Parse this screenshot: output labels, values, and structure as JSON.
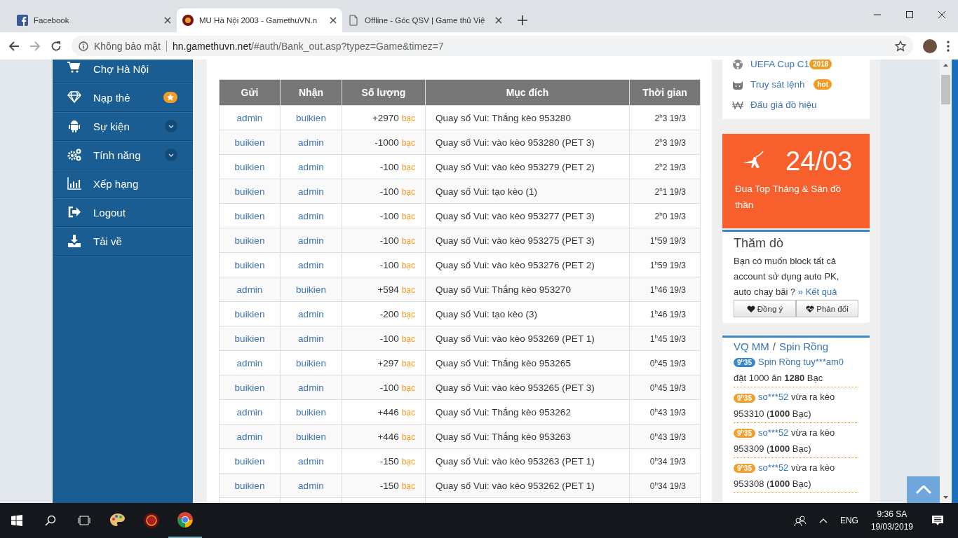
{
  "browser": {
    "tabs": [
      {
        "kind": "facebook",
        "title": "Facebook",
        "selected": false
      },
      {
        "kind": "game",
        "title": "MU Hà Nội 2003 - GamethuVN.n",
        "selected": true
      },
      {
        "kind": "page",
        "title": "Offline - Góc QSV | Game thủ Việ",
        "selected": false
      }
    ],
    "address": {
      "security": "Không bảo mật",
      "host": "hn.gamethuvn.net",
      "path": "/#auth/Bank_out.asp?typez=Game&timez=7"
    }
  },
  "sidebar": {
    "items": [
      {
        "label": "Chợ Hà Nội",
        "kind": "plain"
      },
      {
        "label": "Nạp thẻ",
        "kind": "star"
      },
      {
        "label": "Sự kiện",
        "kind": "chevron"
      },
      {
        "label": "Tính năng",
        "kind": "chevron"
      },
      {
        "label": "Xếp hạng",
        "kind": "plain"
      },
      {
        "label": "Logout",
        "kind": "plain"
      },
      {
        "label": "Tải về",
        "kind": "plain"
      }
    ]
  },
  "table": {
    "columns": [
      "Gửi",
      "Nhận",
      "Số lượng",
      "Mục đích",
      "Thời gian"
    ],
    "rows": [
      {
        "sender": "admin",
        "receiver": "buikien",
        "amount": "+2970",
        "currency": "bạc",
        "purpose": "Quay số Vui: Thắng kèo 953280",
        "time": "2$^{h}$3 19/3"
      },
      {
        "sender": "buikien",
        "receiver": "admin",
        "amount": "-1000",
        "currency": "bạc",
        "purpose": "Quay số Vui: vào kèo 953280 (PET 3)",
        "time": "2$^{h}$3 19/3"
      },
      {
        "sender": "buikien",
        "receiver": "admin",
        "amount": "-100",
        "currency": "bạc",
        "purpose": "Quay số Vui: vào kèo 953279 (PET 2)",
        "time": "2$^{h}$2 19/3"
      },
      {
        "sender": "buikien",
        "receiver": "admin",
        "amount": "-100",
        "currency": "bạc",
        "purpose": "Quay số Vui: tạo kèo (1)",
        "time": "2$^{h}$1 19/3"
      },
      {
        "sender": "buikien",
        "receiver": "admin",
        "amount": "-100",
        "currency": "bạc",
        "purpose": "Quay số Vui: vào kèo 953277 (PET 3)",
        "time": "2$^{h}$0 19/3"
      },
      {
        "sender": "buikien",
        "receiver": "admin",
        "amount": "-100",
        "currency": "bạc",
        "purpose": "Quay số Vui: vào kèo 953275 (PET 3)",
        "time": "1$^{h}$59 19/3"
      },
      {
        "sender": "buikien",
        "receiver": "admin",
        "amount": "-100",
        "currency": "bạc",
        "purpose": "Quay số Vui: vào kèo 953276 (PET 2)",
        "time": "1$^{h}$59 19/3"
      },
      {
        "sender": "admin",
        "receiver": "buikien",
        "amount": "+594",
        "currency": "bạc",
        "purpose": "Quay số Vui: Thắng kèo 953270",
        "time": "1$^{h}$46 19/3"
      },
      {
        "sender": "buikien",
        "receiver": "admin",
        "amount": "-200",
        "currency": "bạc",
        "purpose": "Quay số Vui: tạo kèo (3)",
        "time": "1$^{h}$46 19/3"
      },
      {
        "sender": "buikien",
        "receiver": "admin",
        "amount": "-100",
        "currency": "bạc",
        "purpose": "Quay số Vui: vào kèo 953269 (PET 1)",
        "time": "1$^{h}$45 19/3"
      },
      {
        "sender": "admin",
        "receiver": "buikien",
        "amount": "+297",
        "currency": "bạc",
        "purpose": "Quay số Vui: Thắng kèo 953265",
        "time": "0$^{h}$45 19/3"
      },
      {
        "sender": "buikien",
        "receiver": "admin",
        "amount": "-100",
        "currency": "bạc",
        "purpose": "Quay số Vui: vào kèo 953265 (PET 3)",
        "time": "0$^{h}$45 19/3"
      },
      {
        "sender": "admin",
        "receiver": "buikien",
        "amount": "+446",
        "currency": "bạc",
        "purpose": "Quay số Vui: Thắng kèo 953262",
        "time": "0$^{h}$43 19/3"
      },
      {
        "sender": "admin",
        "receiver": "buikien",
        "amount": "+446",
        "currency": "bạc",
        "purpose": "Quay số Vui: Thắng kèo 953263",
        "time": "0$^{h}$43 19/3"
      },
      {
        "sender": "buikien",
        "receiver": "admin",
        "amount": "-150",
        "currency": "bạc",
        "purpose": "Quay số Vui: vào kèo 953263 (PET 1)",
        "time": "0$^{h}$34 19/3"
      },
      {
        "sender": "buikien",
        "receiver": "admin",
        "amount": "-150",
        "currency": "bạc",
        "purpose": "Quay số Vui: vào kèo 953262 (PET 1)",
        "time": "0$^{h}$34 19/3"
      }
    ]
  },
  "links": [
    {
      "label": "UEFA Cup C1",
      "badge": "2018"
    },
    {
      "label": "Truy sát lệnh",
      "badge": "hot"
    },
    {
      "label": "Đấu giá đồ hiệu"
    }
  ],
  "event": {
    "date": "24/03",
    "caption": "Đua Top Tháng & Săn đồ thần"
  },
  "poll": {
    "title": "Thăm dò",
    "question": "Bạn có muốn block tất cả account sử dụng auto PK, auto chạy bãi ?",
    "result_link": "» Kết quả",
    "buttons": [
      "Đồng ý",
      "Phản đối"
    ]
  },
  "spin": {
    "title_left": "VQ MM",
    "separator": "/",
    "title_right": "Spin Rồng",
    "items": [
      {
        "time": "9$^{h}$35",
        "color": "#3a87c8",
        "link": "Spin Rồng tuy***am0",
        "text": "đặt 1000 ăn **1280** Bạc"
      },
      {
        "time": "9$^{h}$35",
        "color": "#f0a030",
        "link": "so***52",
        "text": "vừa ra kèo 953310 (**1000** Bạc)"
      },
      {
        "time": "9$^{h}$35",
        "color": "#f0a030",
        "link": "so***52",
        "text": "vừa ra kèo 953309 (**1000** Bạc)"
      },
      {
        "time": "9$^{h}$35",
        "color": "#f0a030",
        "link": "so***52",
        "text": "vừa ra kèo 953308 (**1000** Bạc)"
      }
    ]
  },
  "taskbar": {
    "apps": [
      {
        "kind": "paint",
        "open": false
      },
      {
        "kind": "game",
        "open": false
      },
      {
        "kind": "chrome",
        "open": true
      }
    ],
    "language": "ENG",
    "time": "9:36 SA",
    "date": "19/03/2019"
  }
}
